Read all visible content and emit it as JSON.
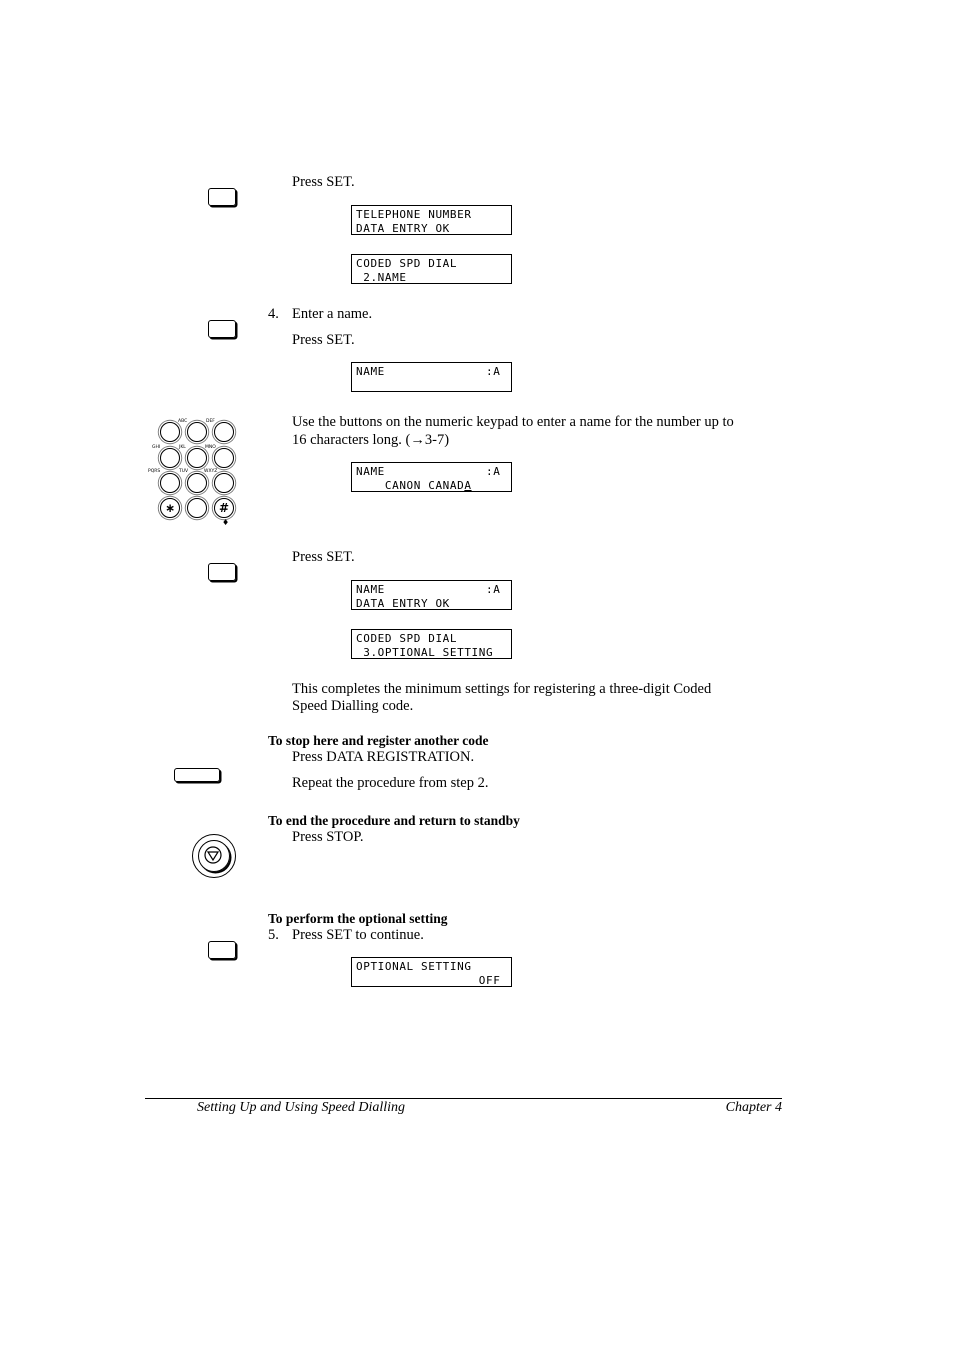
{
  "steps": {
    "press_set_1": "Press SET.",
    "lcd_1": [
      "TELEPHONE NUMBER",
      "DATA ENTRY OK"
    ],
    "lcd_2": [
      "CODED SPD DIAL",
      " 2.NAME"
    ],
    "step4_num": "4.",
    "step4_text": "Enter a name.",
    "press_set_2": "Press SET.",
    "lcd_3": [
      "NAME              :A",
      "    _"
    ],
    "keypad_text_1": "Use the buttons on the numeric keypad to enter a name for the number up to",
    "keypad_text_2": "16 characters long. (→3-7)",
    "lcd_4_line1": "NAME              :A",
    "lcd_4_line2": "    CANON CANAD",
    "lcd_4_cursor": "A",
    "press_set_3": "Press SET.",
    "lcd_5": [
      "NAME              :A",
      "DATA ENTRY OK"
    ],
    "lcd_6": [
      "CODED SPD DIAL",
      " 3.OPTIONAL SETTING"
    ],
    "complete_1": "This completes the minimum settings for registering a three-digit Coded",
    "complete_2": "Speed Dialling code."
  },
  "keypad": {
    "labels": [
      "ABC",
      "DEF",
      "GHI",
      "JKL",
      "MNO",
      "PQRS",
      "TUV",
      "WXYZ"
    ],
    "star": "∗",
    "hash": "#"
  },
  "sections": {
    "stop_heading": "To stop here and register another code",
    "stop_1": "Press DATA REGISTRATION.",
    "stop_2": "Repeat the procedure from step 2.",
    "end_heading": "To end the procedure and return to standby",
    "end_1": "Press STOP.",
    "opt_heading": "To perform the optional setting",
    "step5_num": "5.",
    "step5_text": "Press SET to continue.",
    "lcd_7": [
      "OPTIONAL SETTING",
      "                 OFF"
    ]
  },
  "footer": {
    "left": "Setting Up and Using Speed Dialling",
    "right": "Chapter 4"
  }
}
